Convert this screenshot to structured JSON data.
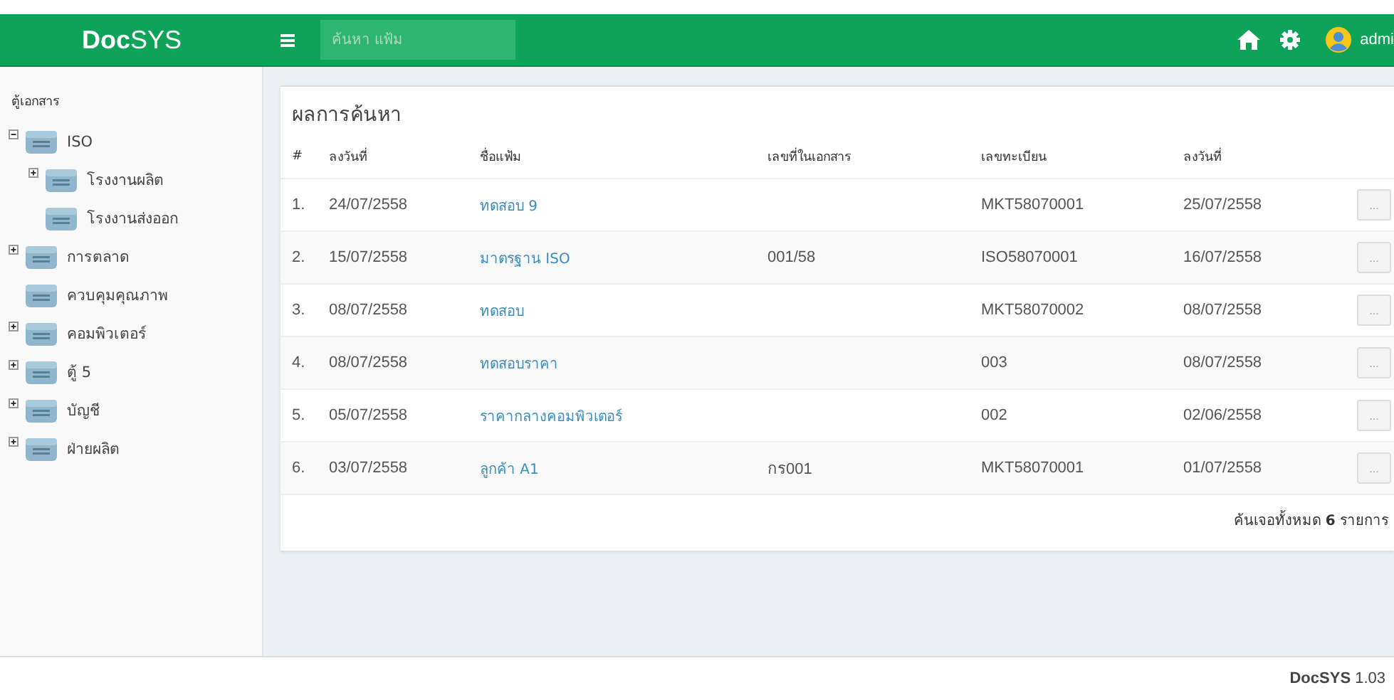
{
  "header": {
    "brand": "**Doc**SYS",
    "search": {
      "placeholder": "ค้นหา แฟ้ม"
    },
    "user": "admi"
  },
  "sidebar": {
    "title": "ตู้เอกสาร",
    "tree": [
      {
        "label": "ISO",
        "kind": "branch",
        "expanded": true,
        "children": [
          {
            "label": "โรงงานผลิต",
            "kind": "branch",
            "expanded": false
          },
          {
            "label": "โรงงานส่งออก",
            "kind": "leaf"
          }
        ]
      },
      {
        "label": "การตลาด",
        "kind": "branch",
        "expanded": false
      },
      {
        "label": "ควบคุมคุณภาพ",
        "kind": "leaf"
      },
      {
        "label": "คอมพิวเตอร์",
        "kind": "branch",
        "expanded": false
      },
      {
        "label": "ตู้ 5",
        "kind": "branch",
        "expanded": false
      },
      {
        "label": "บัญชี",
        "kind": "branch",
        "expanded": false
      },
      {
        "label": "ฝ่ายผลิต",
        "kind": "branch",
        "expanded": false
      }
    ]
  },
  "results": {
    "title": "ผลการค้นหา",
    "columns": [
      "#",
      "ลงวันที่",
      "ชื่อแฟ้ม",
      "เลขที่ในเอกสาร",
      "เลขทะเบียน",
      "ลงวันที่"
    ],
    "rows": [
      {
        "no": "1.",
        "date": "24/07/2558",
        "name": "ทดสอบ 9",
        "doc_no": "",
        "reg_no": "MKT58070001",
        "date2": "25/07/2558",
        "action": "..."
      },
      {
        "no": "2.",
        "date": "15/07/2558",
        "name": "มาตรฐาน ISO",
        "doc_no": "001/58",
        "reg_no": "ISO58070001",
        "date2": "16/07/2558",
        "action": "..."
      },
      {
        "no": "3.",
        "date": "08/07/2558",
        "name": "ทดสอบ",
        "doc_no": "",
        "reg_no": "MKT58070002",
        "date2": "08/07/2558",
        "action": "..."
      },
      {
        "no": "4.",
        "date": "08/07/2558",
        "name": "ทดสอบราคา",
        "doc_no": "",
        "reg_no": "003",
        "date2": "08/07/2558",
        "action": "..."
      },
      {
        "no": "5.",
        "date": "05/07/2558",
        "name": "ราคากลางคอมพิวเตอร์",
        "doc_no": "",
        "reg_no": "002",
        "date2": "02/06/2558",
        "action": "..."
      },
      {
        "no": "6.",
        "date": "03/07/2558",
        "name": "ลูกค้า A1",
        "doc_no": "กร001",
        "reg_no": "MKT58070001",
        "date2": "01/07/2558",
        "action": "..."
      }
    ],
    "total": "ค้นเจอทั้งหมด **6** รายการ"
  },
  "footer": "**DocSYS** 1.03"
}
